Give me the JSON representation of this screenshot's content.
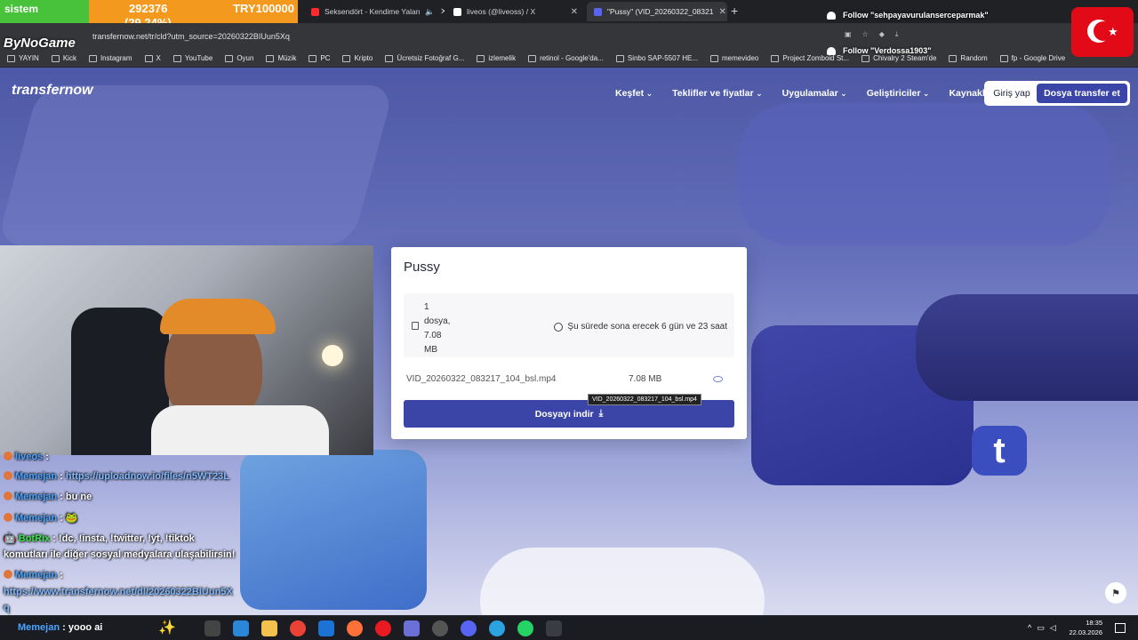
{
  "stream_overlay": {
    "bar_label": "sistem",
    "bar_value": "292376",
    "bar_percent": "(29,24%)",
    "bar_goal": "TRY100000",
    "channel_logo": "ByNoGame"
  },
  "browser": {
    "tabs": [
      {
        "title": "Seksendört - Kendime Yalan",
        "favicon_color": "#ff2a2a"
      },
      {
        "title": "liveos (@liveoss) / X",
        "favicon_color": "#ffffff"
      },
      {
        "title": "\"Pussy\" (VID_20260322_08321",
        "favicon_color": "#5865f2",
        "active": true
      }
    ],
    "url": "transfernow.net/tr/cld?utm_source=20260322BIUun5Xq",
    "bookmarks": [
      "YAYIN",
      "Kick",
      "Instagram",
      "X",
      "YouTube",
      "Oyun",
      "Müzik",
      "PC",
      "Kripto",
      "Ücretsiz Fotoğraf G...",
      "izlemelik",
      "retinol - Google'da...",
      "Sinbo SAP-5507 HE...",
      "memevideo",
      "Project Zomboid St...",
      "Chivalry 2 Steam'de",
      "Random",
      "fp - Google Drive"
    ]
  },
  "site": {
    "logo": "transfernow",
    "nav": [
      "Keşfet",
      "Teklifler ve fiyatlar",
      "Uygulamalar",
      "Geliştiriciler",
      "Kaynaklar"
    ],
    "login": "Giriş yap",
    "transfer_button": "Dosya transfer et"
  },
  "transfer": {
    "title": "Pussy",
    "summary_lines": [
      "1",
      "dosya,",
      "7.08",
      "MB"
    ],
    "expiry": "Şu sürede sona erecek 6 gün ve 23 saat",
    "file_name": "VID_20260322_083217_104_bsl.mp4",
    "file_size": "7.08 MB",
    "tooltip": "VID_20260322_083217_104_bsl.mp4",
    "download_button": "Dosyayı indir"
  },
  "chat": [
    {
      "user": "liveos",
      "message": "",
      "link": false
    },
    {
      "user": "Memejan",
      "message": "https://uploadnow.io/files/n5WT23L",
      "link": true
    },
    {
      "user": "Memejan",
      "message": "bu ne",
      "link": false
    },
    {
      "user": "Memejan",
      "message": "",
      "link": false
    },
    {
      "user": "BotRix",
      "message": "!dc, !insta, !twitter, !yt, !tiktok",
      "link": false
    },
    {
      "user": "",
      "message": "komutları ile diğer sosyal medyalara ulaşabilirsin!",
      "link": false
    },
    {
      "user": "Memejan",
      "message": "",
      "link": false
    },
    {
      "user": "",
      "message": "https://www.transfernow.net/dl/20260322BIUun5X",
      "link": true
    },
    {
      "user": "",
      "message": "q",
      "link": true
    },
    {
      "user": "Memejan",
      "message": "yooo ai",
      "link": false
    }
  ],
  "follows": [
    "Follow \"sehpayavurulanserceparmak\"",
    "Follow \"Verdossa1903\""
  ],
  "taskbar": {
    "time": "18:35",
    "date": "22.03.2026"
  },
  "colors": {
    "brand": "#3b45a8",
    "accent_orange": "#f39a1e",
    "accent_green": "#48c23a"
  }
}
